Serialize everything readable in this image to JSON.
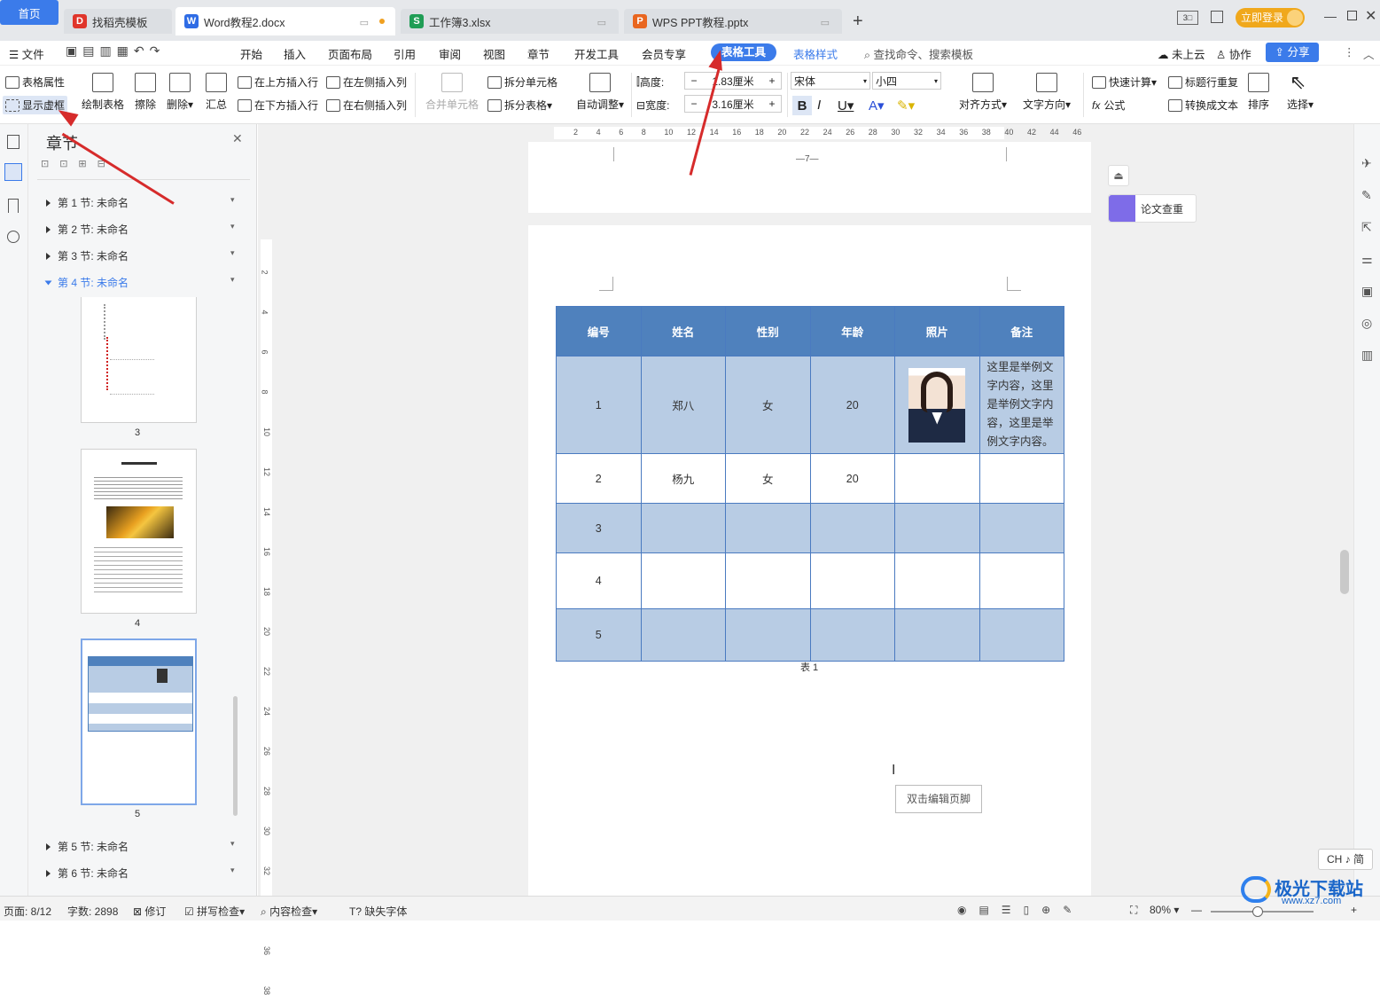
{
  "tabs": {
    "home": "首页",
    "items": [
      {
        "label": "找稻壳模板",
        "icon": "D"
      },
      {
        "label": "Word教程2.docx",
        "icon": "W"
      },
      {
        "label": "工作簿3.xlsx",
        "icon": "S"
      },
      {
        "label": "WPS PPT教程.pptx",
        "icon": "P"
      }
    ],
    "login": "立即登录"
  },
  "menu": {
    "file": "文件",
    "items": [
      "开始",
      "插入",
      "页面布局",
      "引用",
      "审阅",
      "视图",
      "章节",
      "开发工具",
      "会员专享",
      "表格工具",
      "表格样式"
    ],
    "search": "查找命令、搜索模板",
    "cloud": "未上云",
    "collab": "协作",
    "share": "分享"
  },
  "ribbon": {
    "table_props": "表格属性",
    "show_gridlines": "显示虚框",
    "draw_table": "绘制表格",
    "erase": "擦除",
    "delete": "删除",
    "summary": "汇总",
    "insert_above": "在上方插入行",
    "insert_below": "在下方插入行",
    "insert_left": "在左侧插入列",
    "insert_right": "在右侧插入列",
    "merge_cells": "合并单元格",
    "split_cells": "拆分单元格",
    "split_table": "拆分表格",
    "auto_fit": "自动调整",
    "height_label": "高度:",
    "height_value": "1.83厘米",
    "width_label": "宽度:",
    "width_value": "3.16厘米",
    "font": "宋体",
    "font_size": "小四",
    "align": "对齐方式",
    "text_dir": "文字方向",
    "quick_calc": "快速计算",
    "repeat_title": "标题行重复",
    "formula": "公式",
    "to_text": "转换成文本",
    "sort": "排序",
    "select": "选择"
  },
  "nav": {
    "title": "章节",
    "sections": [
      "第 1 节: 未命名",
      "第 2 节: 未命名",
      "第 3 节: 未命名",
      "第 4 节: 未命名"
    ],
    "sections_after": [
      "第 5 节: 未命名",
      "第 6 节: 未命名"
    ],
    "thumb_pages": [
      "3",
      "4",
      "5"
    ]
  },
  "ruler_h": [
    "2",
    "4",
    "6",
    "8",
    "10",
    "12",
    "14",
    "16",
    "18",
    "20",
    "22",
    "24",
    "26",
    "28",
    "30",
    "32",
    "34",
    "36",
    "38",
    "40",
    "42",
    "44",
    "46"
  ],
  "ruler_v": [
    "2",
    "4",
    "6",
    "8",
    "10",
    "12",
    "14",
    "16",
    "18",
    "20",
    "22",
    "24",
    "26",
    "28",
    "30",
    "32",
    "34",
    "36",
    "38"
  ],
  "doc": {
    "page_number": "—7—",
    "table_headers": [
      "编号",
      "姓名",
      "性别",
      "年龄",
      "照片",
      "备注"
    ],
    "rows": [
      {
        "cells": [
          "1",
          "郑八",
          "女",
          "20",
          "",
          "这里是举例文字内容，这里是举例文字内容，这里是举例文字内容。"
        ]
      },
      {
        "cells": [
          "2",
          "杨九",
          "女",
          "20",
          "",
          ""
        ]
      },
      {
        "cells": [
          "3",
          "",
          "",
          "",
          "",
          ""
        ]
      },
      {
        "cells": [
          "4",
          "",
          "",
          "",
          "",
          ""
        ]
      },
      {
        "cells": [
          "5",
          "",
          "",
          "",
          "",
          ""
        ]
      }
    ],
    "caption": "表 1",
    "footer_hint": "双击编辑页脚"
  },
  "side_panel": {
    "paper_check": "论文查重"
  },
  "ime": "CH ♪ 简",
  "status": {
    "page": "页面: 8/12",
    "words": "字数: 2898",
    "revise": "修订",
    "spell": "拼写检查",
    "content_check": "内容检查",
    "missing_font": "缺失字体",
    "zoom": "80%"
  },
  "watermark": {
    "brand": "极光下载站",
    "url": "www.xz7.com"
  },
  "colors": {
    "accent": "#3b7bea",
    "table_header": "#4f81bd",
    "table_band": "#b8cce4",
    "arrow": "#d62b2b"
  }
}
